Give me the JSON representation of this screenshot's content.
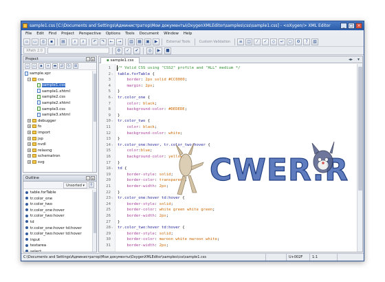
{
  "window": {
    "title": "sample1.css [C:\\Documents and Settings\\Администратор\\Мои документы\\OxygenXMLEditor\\samples\\css\\sample1.css] - <oXygen/> XML Editor",
    "btn_min": "_",
    "btn_max": "□",
    "btn_close": "×"
  },
  "menu": [
    "File",
    "Edit",
    "Find",
    "Project",
    "Perspective",
    "Options",
    "Tools",
    "Document",
    "Window",
    "Help"
  ],
  "toolbar": {
    "xpath_combo": "XPath 2.0",
    "external_tools": "External Tools",
    "custom_validation": "Custom Validation"
  },
  "project": {
    "title": "Project",
    "root": "sample.xpr",
    "css_folder": "css",
    "css_files": [
      "sample1.css",
      "sample1.xhtml",
      "sample2.css",
      "sample2.xhtml",
      "sample3.css",
      "sample3.xhtml"
    ],
    "folders": [
      "debugger",
      "fo",
      "import",
      "jsp",
      "nvdl",
      "relaxng",
      "schematron",
      "svg"
    ]
  },
  "outline": {
    "title": "Outline",
    "sort_label": "Unsorted",
    "items": [
      "table.forTable",
      "tr.color_one",
      "tr.color_two",
      "tr.color_one:hover",
      "tr.color_two:hover",
      "td",
      "tr.color_one:hover td:hover",
      "tr.color_two:hover td:hover",
      "input",
      "textarea",
      "select"
    ]
  },
  "editor": {
    "tab_label": "sample1.css",
    "lines": [
      {
        "n": "1",
        "t": "/* Valid CSS using \"CSS2\" profile and \"ALL\" medium */",
        "k": "com"
      },
      {
        "n": "2",
        "t": "table.forTable {",
        "k": "sel",
        "f": true
      },
      {
        "n": "3",
        "t": "    border: 2px solid #CC0000;",
        "k": "decl"
      },
      {
        "n": "4",
        "t": "    margin: 2px;",
        "k": "decl"
      },
      {
        "n": "5",
        "t": "}",
        "k": "pun"
      },
      {
        "n": "6",
        "t": "tr.color_one {",
        "k": "sel",
        "f": true
      },
      {
        "n": "7",
        "t": "    color: black;",
        "k": "decl"
      },
      {
        "n": "8",
        "t": "    background-color: #DEDEDE;",
        "k": "decl"
      },
      {
        "n": "9",
        "t": "}",
        "k": "pun"
      },
      {
        "n": "10",
        "t": "tr.color_two {",
        "k": "sel",
        "f": true
      },
      {
        "n": "11",
        "t": "    color: black;",
        "k": "decl"
      },
      {
        "n": "12",
        "t": "    background-color: white;",
        "k": "decl"
      },
      {
        "n": "13",
        "t": "}",
        "k": "pun"
      },
      {
        "n": "14",
        "t": "tr.color_one:hover, tr.color_two:hover {",
        "k": "sel",
        "f": true
      },
      {
        "n": "15",
        "t": "    color:blue;",
        "k": "decl"
      },
      {
        "n": "16",
        "t": "    background-color: yellow;",
        "k": "decl"
      },
      {
        "n": "17",
        "t": "}",
        "k": "pun"
      },
      {
        "n": "18",
        "t": "td {",
        "k": "sel",
        "f": true
      },
      {
        "n": "19",
        "t": "    border-style: solid;",
        "k": "decl"
      },
      {
        "n": "20",
        "t": "    border-color: transparent;",
        "k": "decl"
      },
      {
        "n": "21",
        "t": "    border-width: 2px;",
        "k": "decl"
      },
      {
        "n": "22",
        "t": "}",
        "k": "pun"
      },
      {
        "n": "23",
        "t": "tr.color_one:hover td:hover {",
        "k": "sel",
        "f": true
      },
      {
        "n": "24",
        "t": "    border-style: solid;",
        "k": "decl"
      },
      {
        "n": "25",
        "t": "    border-color: white green white green;",
        "k": "decl"
      },
      {
        "n": "26",
        "t": "    border-width: 2px;",
        "k": "decl"
      },
      {
        "n": "27",
        "t": "}",
        "k": "pun"
      },
      {
        "n": "28",
        "t": "tr.color_two:hover td:hover {",
        "k": "sel",
        "f": true
      },
      {
        "n": "29",
        "t": "    border-style: solid;",
        "k": "decl"
      },
      {
        "n": "30",
        "t": "    border-color: maroon white maroon white;",
        "k": "decl"
      },
      {
        "n": "31",
        "t": "    border-width: 2px;",
        "k": "decl"
      }
    ]
  },
  "status": {
    "path": "C:\\Documents and Settings\\Администратор\\Мои документы\\OxygenXMLEditor\\samples\\css\\sample1.css",
    "encoding": "U+002F",
    "position": "1:1"
  },
  "watermark": {
    "text": "CWER.RU"
  },
  "colors": {
    "accent": "#316ac5",
    "title_bar": "#2a5ba8",
    "watermark": "#3a5fb0"
  }
}
